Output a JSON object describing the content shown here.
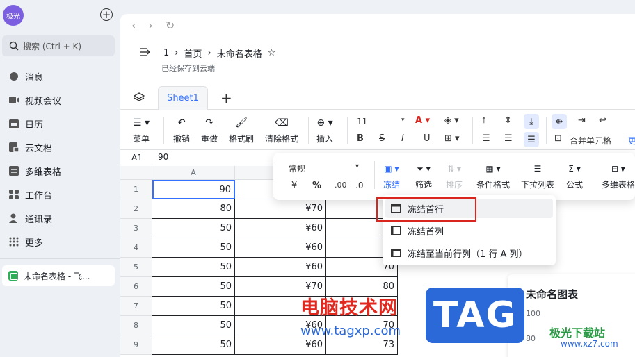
{
  "sidebar": {
    "avatar": "极光",
    "search_placeholder": "搜索 (Ctrl + K)",
    "items": [
      {
        "label": "消息",
        "icon": "message-icon"
      },
      {
        "label": "视频会议",
        "icon": "video-icon"
      },
      {
        "label": "日历",
        "icon": "calendar-icon"
      },
      {
        "label": "云文档",
        "icon": "cloud-doc-icon"
      },
      {
        "label": "多维表格",
        "icon": "base-icon"
      },
      {
        "label": "工作台",
        "icon": "workplace-icon"
      },
      {
        "label": "通讯录",
        "icon": "contacts-icon"
      },
      {
        "label": "更多",
        "icon": "more-icon"
      }
    ],
    "open_doc": "未命名表格 - 飞..."
  },
  "header": {
    "crumb_root": "1",
    "crumb_home": "首页",
    "title": "未命名表格",
    "saved": "已经保存到云端"
  },
  "tabs": {
    "sheet": "Sheet1"
  },
  "toolbar": {
    "menu": "菜单",
    "undo": "撤销",
    "redo": "重做",
    "format_painter": "格式刷",
    "clear_format": "清除格式",
    "insert": "插入",
    "font_size": "11",
    "merge": "合并单元格",
    "more_cut": "更"
  },
  "formula": {
    "cell": "A1",
    "value": "90"
  },
  "grid": {
    "col_a": "A",
    "rows": [
      {
        "n": "1",
        "a": "90",
        "b": "",
        "c": ""
      },
      {
        "n": "2",
        "a": "80",
        "b": "¥70",
        "c": ""
      },
      {
        "n": "3",
        "a": "50",
        "b": "¥60",
        "c": ""
      },
      {
        "n": "4",
        "a": "50",
        "b": "¥60",
        "c": ""
      },
      {
        "n": "5",
        "a": "50",
        "b": "¥60",
        "c": "70"
      },
      {
        "n": "6",
        "a": "50",
        "b": "¥70",
        "c": "80"
      },
      {
        "n": "7",
        "a": "50",
        "b": "",
        "c": ""
      },
      {
        "n": "8",
        "a": "50",
        "b": "¥60",
        "c": "70"
      },
      {
        "n": "9",
        "a": "50",
        "b": "¥60",
        "c": "73"
      }
    ]
  },
  "chart": {
    "title": "未命名图表",
    "y1": "100",
    "y2": "80"
  },
  "popbar": {
    "format": "常规",
    "currency": "¥",
    "percent": "%",
    "freeze": "冻结",
    "filter": "筛选",
    "sort": "排序",
    "cond_format": "条件格式",
    "dropdown_list": "下拉列表",
    "formula": "公式",
    "base": "多维表格"
  },
  "freeze_menu": {
    "first_row": "冻结首行",
    "first_col": "冻结首列",
    "to_current": "冻结至当前行列（1 行 A 列）"
  },
  "watermark": {
    "brand": "电脑技术网",
    "url": "www.tagxp.com",
    "tag": "TAG",
    "site2": "极光下载站",
    "site2_url": "www.xz7.com"
  }
}
